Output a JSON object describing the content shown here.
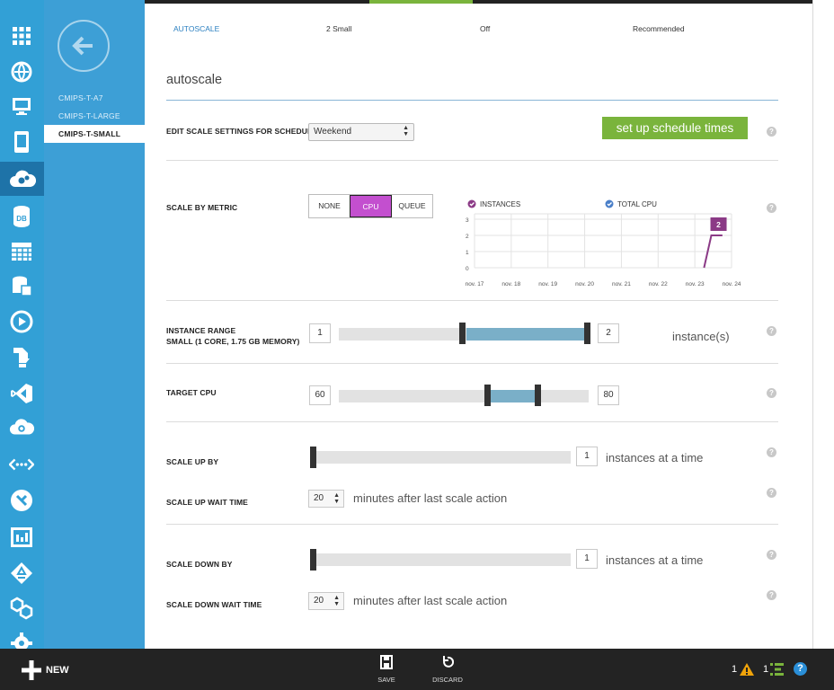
{
  "table_row": {
    "name": "AUTOSCALE",
    "size": "2 Small",
    "status": "Off",
    "recommendation": "Recommended"
  },
  "section_title": "autoscale",
  "nav": {
    "items": [
      "CMIPS-T-A7",
      "CMIPS-T-LARGE",
      "CMIPS-T-SMALL"
    ],
    "selected": "CMIPS-T-SMALL"
  },
  "schedule": {
    "label": "EDIT SCALE SETTINGS FOR SCHEDULE",
    "value": "Weekend",
    "button": "set up schedule times"
  },
  "metric": {
    "label": "SCALE BY METRIC",
    "options": [
      "NONE",
      "CPU",
      "QUEUE"
    ],
    "selected": "CPU"
  },
  "chart_data": {
    "type": "line",
    "legend": [
      {
        "name": "INSTANCES",
        "color": "#8b3a86"
      },
      {
        "name": "TOTAL CPU",
        "color": "#4a7fc8"
      }
    ],
    "x": [
      "nov. 17",
      "nov. 18",
      "nov. 19",
      "nov. 20",
      "nov. 21",
      "nov. 22",
      "nov. 23",
      "nov. 24"
    ],
    "yticks": [
      "3",
      "2",
      "1",
      "0"
    ],
    "ylim": [
      0,
      3
    ],
    "series": [
      {
        "name": "INSTANCES",
        "points": [
          [
            6.25,
            0
          ],
          [
            6.45,
            2
          ],
          [
            6.75,
            2
          ]
        ],
        "label": "2"
      }
    ]
  },
  "instance_range": {
    "label": "INSTANCE RANGE",
    "sublabel": "SMALL (1 CORE, 1.75 GB MEMORY)",
    "min": "1",
    "max": "2",
    "unit": "instance(s)"
  },
  "target_cpu": {
    "label": "TARGET CPU",
    "min": "60",
    "max": "80"
  },
  "scale_up": {
    "by_label": "SCALE UP BY",
    "by_value": "1",
    "by_unit": "instances at a time",
    "wait_label": "SCALE UP WAIT TIME",
    "wait_value": "20",
    "wait_unit": "minutes after last scale action"
  },
  "scale_down": {
    "by_label": "SCALE DOWN BY",
    "by_value": "1",
    "by_unit": "instances at a time",
    "wait_label": "SCALE DOWN WAIT TIME",
    "wait_value": "20",
    "wait_unit": "minutes after last scale action"
  },
  "bottom": {
    "new": "NEW",
    "save": "SAVE",
    "discard": "DISCARD",
    "warnings": "1",
    "notifications": "1",
    "help": "?"
  },
  "colors": {
    "accent": "#32a0d6",
    "cpu_selected": "#c34fcf",
    "schedule_btn": "#7ab43c",
    "range_fill": "#7aafc8"
  },
  "help_icon": "?"
}
